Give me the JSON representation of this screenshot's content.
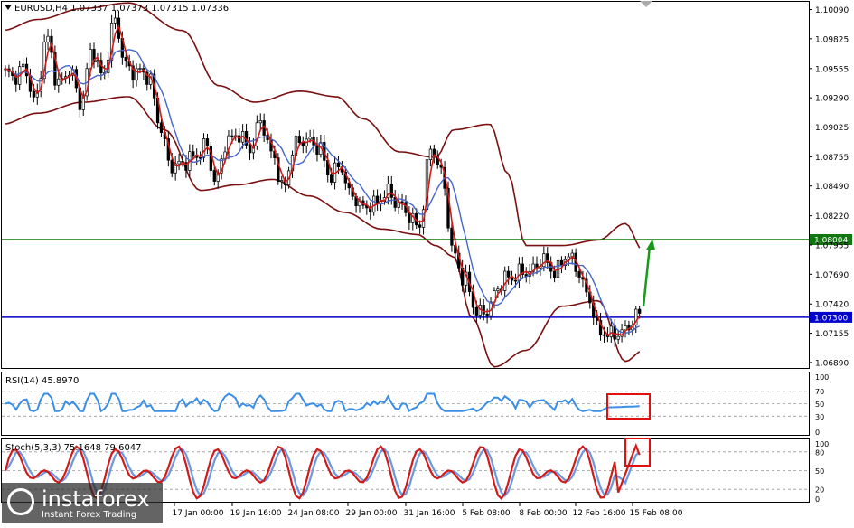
{
  "main_header": {
    "symbol_info": "EURUSD,H4  1.07337 1.07373 1.07315 1.07336"
  },
  "rsi_header": {
    "label": "RSI(14) 45.8970"
  },
  "stoch_header": {
    "label": "Stoch(5,3,3) 75.1648 79.6047"
  },
  "logo": {
    "name": "instaforex",
    "tagline": "Instant Forex Trading"
  },
  "colors": {
    "candles": "#000000",
    "bollinger": "#7a1010",
    "fast_ma": "#d11a1a",
    "slow_ma": "#4466cc",
    "support_line": "#0000cc",
    "resistance_line": "#117711",
    "rsi_line": "#3a8ee6",
    "stoch_main": "#d11a1a",
    "stoch_signal": "#6a98e0",
    "highlight_box": "#e01010",
    "arrow": "#1a9a1a"
  },
  "chart_data": {
    "type": "candlestick",
    "symbol": "EURUSD",
    "timeframe": "H4",
    "last_bar": {
      "open": 1.07337,
      "high": 1.07373,
      "low": 1.07315,
      "close": 1.07336
    },
    "price_axis_ticks": [
      "1.10090",
      "1.09825",
      "1.09555",
      "1.09290",
      "1.09025",
      "1.08755",
      "1.08490",
      "1.08220",
      "1.07955",
      "1.07690",
      "1.07420",
      "1.07155",
      "1.06890"
    ],
    "ylim": [
      1.0684,
      1.1016
    ],
    "time_labels": [
      "17 Jan 00:00",
      "19 Jan 16:00",
      "24 Jan 08:00",
      "29 Jan 00:00",
      "31 Jan 16:00",
      "5 Feb 08:00",
      "8 Feb 00:00",
      "12 Feb 16:00",
      "15 Feb 08:00"
    ],
    "horizontal_levels": [
      {
        "price": 1.08004,
        "label": "1.08004"
      },
      {
        "price": 1.073,
        "label": "1.07300"
      }
    ],
    "price_keypoints": [
      [
        0,
        1.095
      ],
      [
        12,
        1.0945
      ],
      [
        25,
        1.096
      ],
      [
        37,
        1.0925
      ],
      [
        50,
        1.098
      ],
      [
        62,
        1.0945
      ],
      [
        75,
        1.0955
      ],
      [
        87,
        1.092
      ],
      [
        100,
        1.0975
      ],
      [
        112,
        1.095
      ],
      [
        125,
        1.0995
      ],
      [
        137,
        1.096
      ],
      [
        150,
        1.0955
      ],
      [
        162,
        1.0945
      ],
      [
        175,
        1.0905
      ],
      [
        187,
        1.087
      ],
      [
        200,
        1.0865
      ],
      [
        212,
        1.0875
      ],
      [
        225,
        1.089
      ],
      [
        237,
        1.085
      ],
      [
        250,
        1.089
      ],
      [
        262,
        1.09
      ],
      [
        275,
        1.088
      ],
      [
        287,
        1.0905
      ],
      [
        300,
        1.088
      ],
      [
        312,
        1.0845
      ],
      [
        325,
        1.0885
      ],
      [
        337,
        1.0895
      ],
      [
        350,
        1.0885
      ],
      [
        362,
        1.0855
      ],
      [
        375,
        1.087
      ],
      [
        387,
        1.084
      ],
      [
        400,
        1.0825
      ],
      [
        412,
        1.0835
      ],
      [
        425,
        1.0845
      ],
      [
        437,
        1.083
      ],
      [
        450,
        1.0825
      ],
      [
        462,
        1.0815
      ],
      [
        475,
        1.088
      ],
      [
        487,
        1.086
      ],
      [
        500,
        1.079
      ],
      [
        512,
        1.076
      ],
      [
        525,
        1.0735
      ],
      [
        537,
        1.074
      ],
      [
        550,
        1.0755
      ],
      [
        562,
        1.0765
      ],
      [
        575,
        1.0775
      ],
      [
        587,
        1.077
      ],
      [
        600,
        1.078
      ],
      [
        612,
        1.0775
      ],
      [
        625,
        1.0785
      ],
      [
        637,
        1.077
      ],
      [
        650,
        1.075
      ],
      [
        662,
        1.0715
      ],
      [
        675,
        1.071
      ],
      [
        687,
        1.072
      ],
      [
        700,
        1.073
      ],
      [
        709,
        1.07336
      ]
    ],
    "upper_band_keypoints": [
      [
        0,
        1.099
      ],
      [
        40,
        1.1
      ],
      [
        90,
        1.101
      ],
      [
        140,
        1.1015
      ],
      [
        200,
        1.099
      ],
      [
        240,
        1.094
      ],
      [
        280,
        1.0925
      ],
      [
        330,
        1.0935
      ],
      [
        370,
        1.093
      ],
      [
        400,
        1.091
      ],
      [
        440,
        1.088
      ],
      [
        480,
        1.0875
      ],
      [
        500,
        1.09
      ],
      [
        540,
        1.0905
      ],
      [
        560,
        1.086
      ],
      [
        580,
        1.0795
      ],
      [
        620,
        1.0795
      ],
      [
        660,
        1.08
      ],
      [
        690,
        1.0815
      ],
      [
        710,
        1.079
      ]
    ],
    "lower_band_keypoints": [
      [
        0,
        1.0905
      ],
      [
        40,
        1.0915
      ],
      [
        90,
        1.0925
      ],
      [
        140,
        1.093
      ],
      [
        180,
        1.09
      ],
      [
        220,
        1.0845
      ],
      [
        260,
        1.085
      ],
      [
        300,
        1.0855
      ],
      [
        340,
        1.084
      ],
      [
        380,
        1.0825
      ],
      [
        420,
        1.081
      ],
      [
        460,
        1.0805
      ],
      [
        480,
        1.0795
      ],
      [
        500,
        1.0785
      ],
      [
        520,
        1.073
      ],
      [
        545,
        1.0685
      ],
      [
        580,
        1.07
      ],
      [
        620,
        1.074
      ],
      [
        660,
        1.0745
      ],
      [
        690,
        1.069
      ],
      [
        710,
        1.07
      ]
    ],
    "rsi": {
      "period": 14,
      "value": 45.897,
      "levels": [
        70,
        50,
        30
      ],
      "scale_labels": [
        "100",
        "70",
        "50",
        "30",
        "0"
      ]
    },
    "stochastic": {
      "params": [
        5,
        3,
        3
      ],
      "main": 75.1648,
      "signal": 79.6047,
      "levels": [
        80,
        50,
        20
      ],
      "scale_labels": [
        "100",
        "80",
        "50",
        "20",
        "0"
      ]
    },
    "annotations": [
      {
        "type": "box",
        "pane": "rsi",
        "around": "latest RSI readings"
      },
      {
        "type": "box",
        "pane": "stoch",
        "around": "latest Stochastic readings"
      },
      {
        "type": "arrow",
        "direction": "up",
        "from_price": 1.07336,
        "to_price": 1.08
      }
    ]
  }
}
